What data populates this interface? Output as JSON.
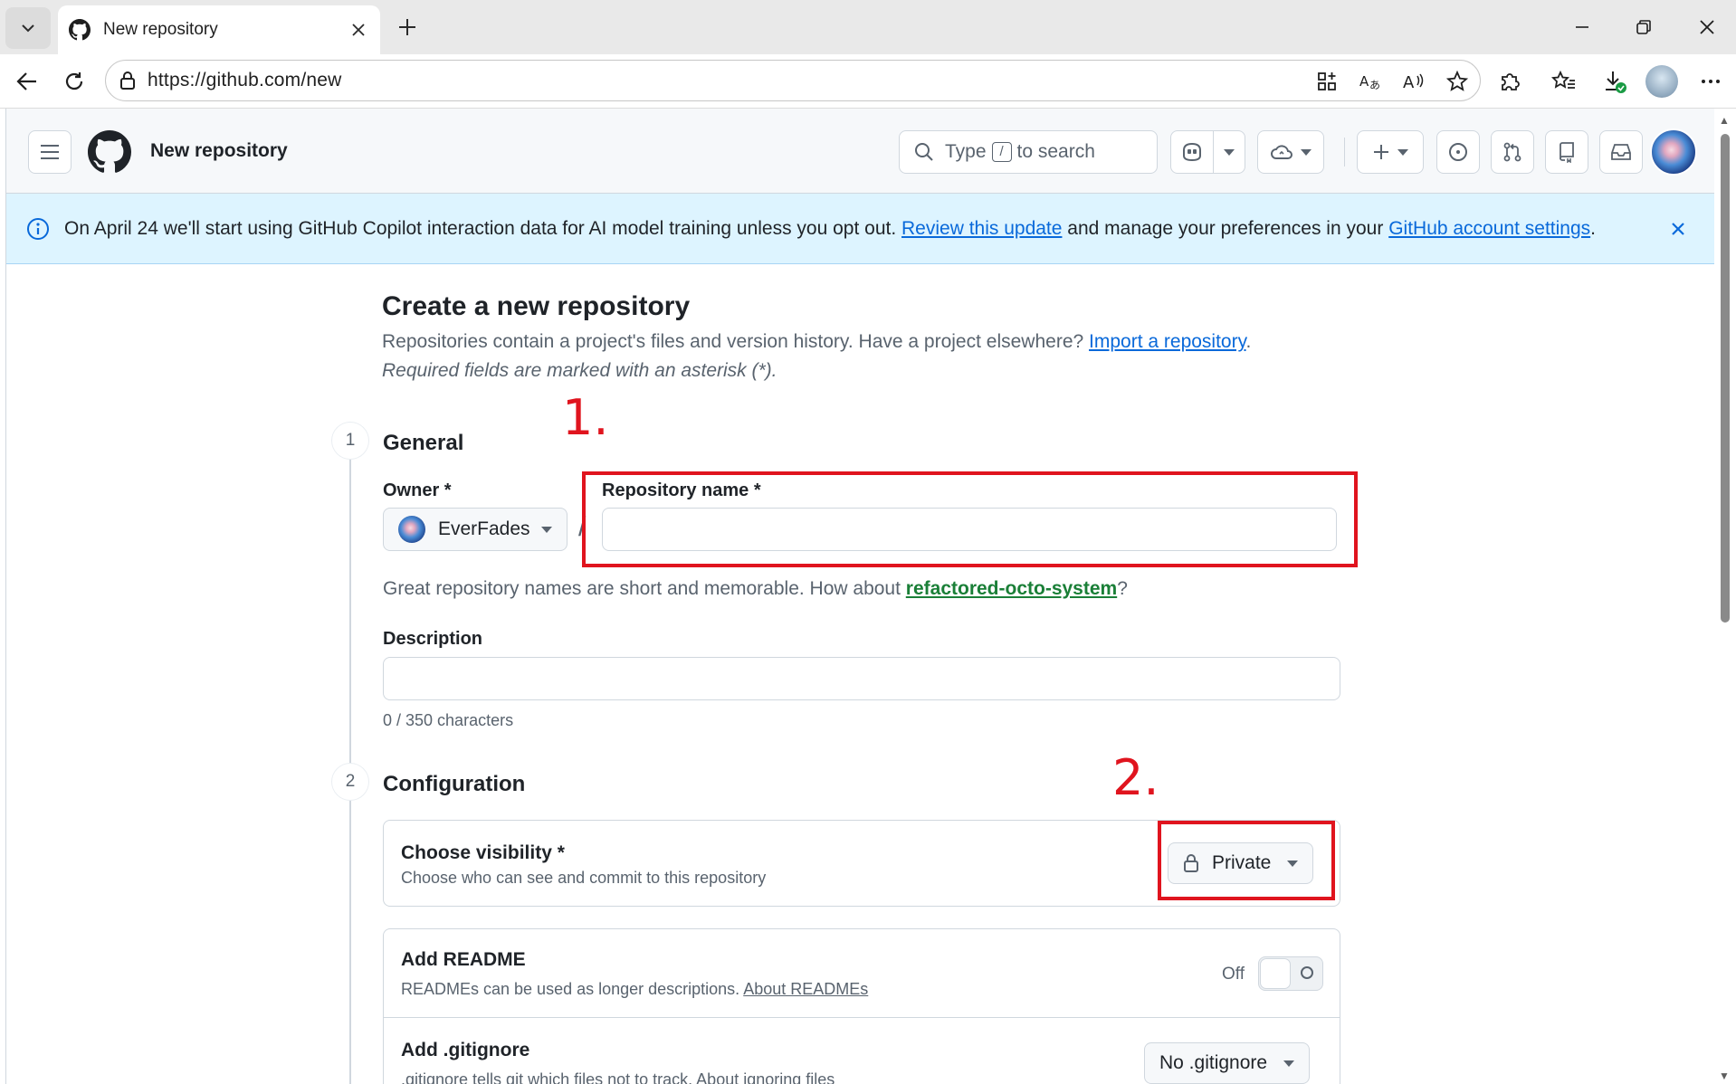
{
  "browser": {
    "tab_title": "New repository",
    "url": "https://github.com/new"
  },
  "header": {
    "title": "New repository",
    "search_pre": "Type",
    "search_key": "/",
    "search_post": "to search"
  },
  "banner": {
    "text_1": "On April 24 we'll start using GitHub Copilot interaction data for AI model training unless you opt out.",
    "link_1": "Review this update",
    "text_2": "and manage your preferences in your",
    "link_2": "GitHub account settings",
    "text_3": "."
  },
  "main": {
    "title": "Create a new repository",
    "subtitle": "Repositories contain a project's files and version history. Have a project elsewhere?",
    "import_link": "Import a repository",
    "subtitle_end": ".",
    "required_note": "Required fields are marked with an asterisk (*)."
  },
  "general": {
    "step": "1",
    "title": "General",
    "owner_label": "Owner *",
    "owner_value": "EverFades",
    "slash": "/",
    "repo_name_label": "Repository name *",
    "repo_name_value": "",
    "hint_pre": "Great repository names are short and memorable. How about",
    "hint_suggestion": "refactored-octo-system",
    "hint_post": "?",
    "description_label": "Description",
    "description_value": "",
    "char_count": "0 / 350 characters"
  },
  "configuration": {
    "step": "2",
    "title": "Configuration",
    "visibility_title": "Choose visibility *",
    "visibility_desc": "Choose who can see and commit to this repository",
    "visibility_value": "Private",
    "readme_title": "Add README",
    "readme_desc": "READMEs can be used as longer descriptions.",
    "readme_link": "About READMEs",
    "readme_toggle_label": "Off",
    "gitignore_title": "Add .gitignore",
    "gitignore_desc": ".gitignore tells git which files not to track.",
    "gitignore_link": "About ignoring files",
    "gitignore_value": "No .gitignore"
  },
  "annotations": {
    "note_1": "1.",
    "note_2": "2.",
    "color": "#e0141e"
  },
  "colors": {
    "link": "#0969da",
    "suggestion": "#1a7f37",
    "banner_bg": "#ddf4ff"
  }
}
